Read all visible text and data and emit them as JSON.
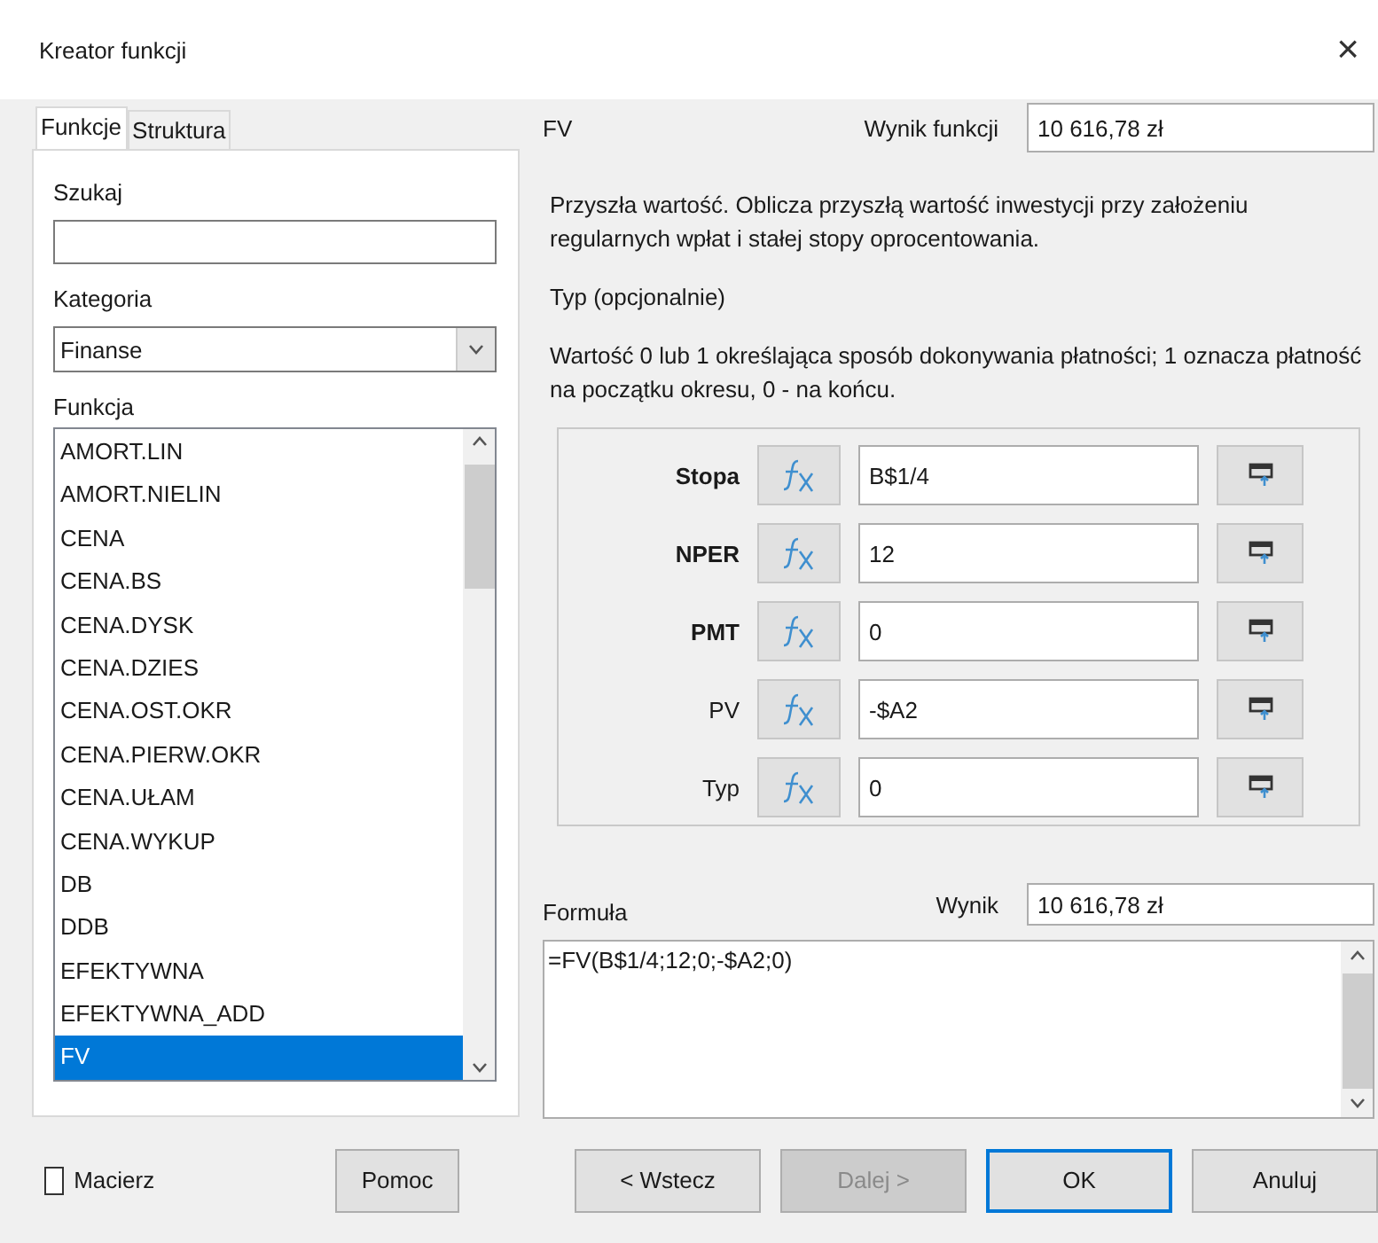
{
  "window": {
    "title": "Kreator funkcji",
    "close": "×"
  },
  "tabs": [
    {
      "label": "Funkcje",
      "selected": true
    },
    {
      "label": "Struktura",
      "selected": false
    }
  ],
  "search": {
    "label": "Szukaj"
  },
  "category": {
    "label": "Kategoria",
    "value": "Finanse"
  },
  "function_list": {
    "label": "Funkcja",
    "items": [
      {
        "label": "AMORT.LIN",
        "selected": false
      },
      {
        "label": "AMORT.NIELIN",
        "selected": false
      },
      {
        "label": "CENA",
        "selected": false
      },
      {
        "label": "CENA.BS",
        "selected": false
      },
      {
        "label": "CENA.DYSK",
        "selected": false
      },
      {
        "label": "CENA.DZIES",
        "selected": false
      },
      {
        "label": "CENA.OST.OKR",
        "selected": false
      },
      {
        "label": "CENA.PIERW.OKR",
        "selected": false
      },
      {
        "label": "CENA.UŁAM",
        "selected": false
      },
      {
        "label": "CENA.WYKUP",
        "selected": false
      },
      {
        "label": "DB",
        "selected": false
      },
      {
        "label": "DDB",
        "selected": false
      },
      {
        "label": "EFEKTYWNA",
        "selected": false
      },
      {
        "label": "EFEKTYWNA_ADD",
        "selected": false
      },
      {
        "label": "FV",
        "selected": true
      }
    ]
  },
  "array_checkbox": {
    "label": "Macierz",
    "checked": false
  },
  "help_button": "Pomoc",
  "function_name": "FV",
  "function_result": {
    "label": "Wynik funkcji",
    "value": "10 616,78 zł"
  },
  "description": "Przyszła wartość. Oblicza przyszłą wartość inwestycji przy założeniu regularnych wpłat i stałej stopy oprocentowania.",
  "argument": {
    "name": "Typ (opcjonalnie)",
    "description": "Wartość 0 lub 1 określająca sposób dokonywania płatności; 1 oznacza płatność na początku okresu, 0 - na końcu."
  },
  "arguments": [
    {
      "label": "Stopa",
      "required": true,
      "value": "B$1/4"
    },
    {
      "label": "NPER",
      "required": true,
      "value": "12"
    },
    {
      "label": "PMT",
      "required": true,
      "value": "0"
    },
    {
      "label": "PV",
      "required": false,
      "value": "-$A2"
    },
    {
      "label": "Typ",
      "required": false,
      "value": "0"
    }
  ],
  "formula": {
    "label": "Formuła",
    "value": "=FV(B$1/4;12;0;-$A2;0)"
  },
  "result": {
    "label": "Wynik",
    "value": "10 616,78 zł"
  },
  "buttons": [
    {
      "label": "< Wstecz",
      "disabled": false,
      "default": false
    },
    {
      "label": "Dalej >",
      "disabled": true,
      "default": false
    },
    {
      "label": "OK",
      "disabled": false,
      "default": true
    },
    {
      "label": "Anuluj",
      "disabled": false,
      "default": false
    }
  ]
}
